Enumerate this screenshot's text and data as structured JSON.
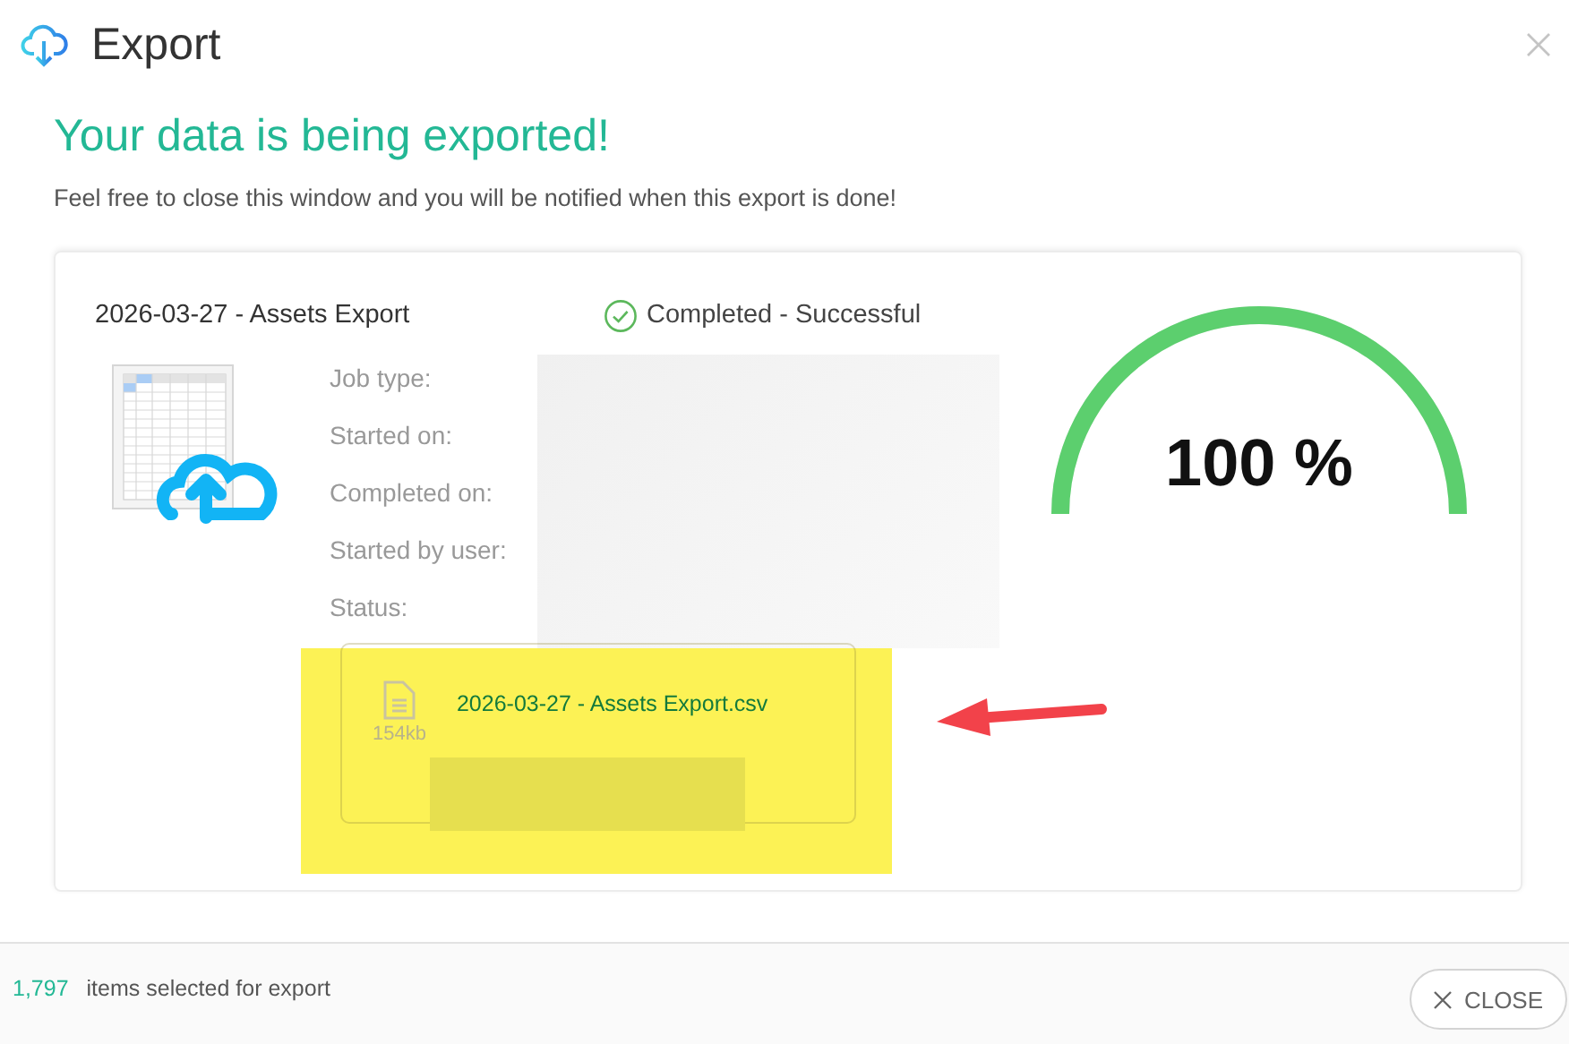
{
  "window": {
    "title": "Export"
  },
  "heading": "Your data is being exported!",
  "message": "Feel free to close this window and you will be notified when this export is done!",
  "job": {
    "title": "2026-03-27 - Assets Export",
    "status": {
      "text": "Completed - Successful",
      "success": true
    },
    "fields": [
      "Job type:",
      "Started on:",
      "Completed on:",
      "Started by user:",
      "Status:"
    ],
    "file": {
      "name": "2026-03-27 - Assets Export.csv",
      "size": "154kb"
    },
    "progress": {
      "level": 1,
      "reading": "100 %"
    }
  },
  "footer": {
    "count": "1,797",
    "text": "items selected for export",
    "close_button": "CLOSE"
  }
}
